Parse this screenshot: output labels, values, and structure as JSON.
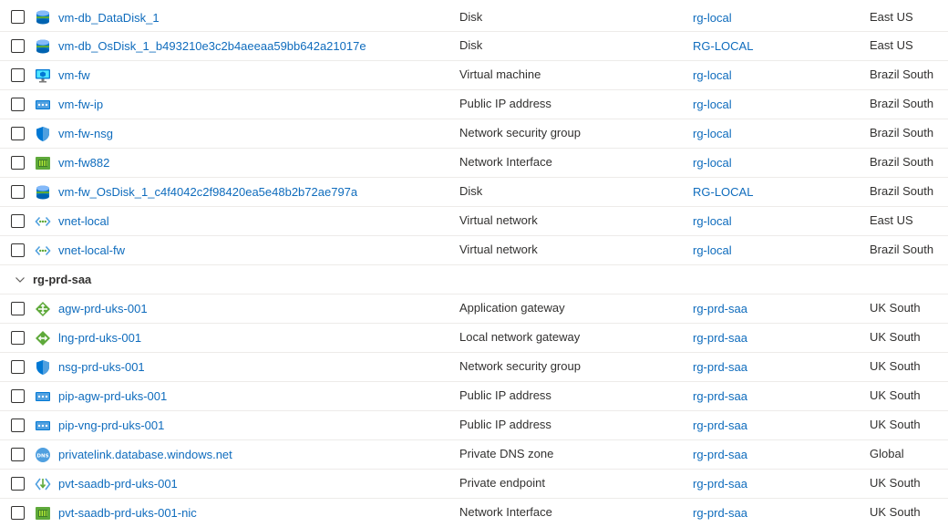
{
  "colors": {
    "link": "#0f6cbd",
    "text": "#323130",
    "divider": "#edebe9"
  },
  "rows_top": [
    {
      "name": "vm-db_DataDisk_1",
      "type": "Disk",
      "rg": "rg-local",
      "location": "East US",
      "icon": "disk-icon"
    },
    {
      "name": "vm-db_OsDisk_1_b493210e3c2b4aeeaa59bb642a21017e",
      "type": "Disk",
      "rg": "RG-LOCAL",
      "location": "East US",
      "icon": "disk-icon"
    },
    {
      "name": "vm-fw",
      "type": "Virtual machine",
      "rg": "rg-local",
      "location": "Brazil South",
      "icon": "virtual-machine-icon"
    },
    {
      "name": "vm-fw-ip",
      "type": "Public IP address",
      "rg": "rg-local",
      "location": "Brazil South",
      "icon": "public-ip-icon"
    },
    {
      "name": "vm-fw-nsg",
      "type": "Network security group",
      "rg": "rg-local",
      "location": "Brazil South",
      "icon": "shield-icon"
    },
    {
      "name": "vm-fw882",
      "type": "Network Interface",
      "rg": "rg-local",
      "location": "Brazil South",
      "icon": "network-interface-icon"
    },
    {
      "name": "vm-fw_OsDisk_1_c4f4042c2f98420ea5e48b2b72ae797a",
      "type": "Disk",
      "rg": "RG-LOCAL",
      "location": "Brazil South",
      "icon": "disk-icon"
    },
    {
      "name": "vnet-local",
      "type": "Virtual network",
      "rg": "rg-local",
      "location": "East US",
      "icon": "virtual-network-icon"
    },
    {
      "name": "vnet-local-fw",
      "type": "Virtual network",
      "rg": "rg-local",
      "location": "Brazil South",
      "icon": "virtual-network-icon"
    }
  ],
  "group": {
    "label": "rg-prd-saa",
    "icon": "chevron-down-icon"
  },
  "rows_group": [
    {
      "name": "agw-prd-uks-001",
      "type": "Application gateway",
      "rg": "rg-prd-saa",
      "location": "UK South",
      "icon": "application-gateway-icon"
    },
    {
      "name": "lng-prd-uks-001",
      "type": "Local network gateway",
      "rg": "rg-prd-saa",
      "location": "UK South",
      "icon": "local-network-gateway-icon"
    },
    {
      "name": "nsg-prd-uks-001",
      "type": "Network security group",
      "rg": "rg-prd-saa",
      "location": "UK South",
      "icon": "shield-icon"
    },
    {
      "name": "pip-agw-prd-uks-001",
      "type": "Public IP address",
      "rg": "rg-prd-saa",
      "location": "UK South",
      "icon": "public-ip-icon"
    },
    {
      "name": "pip-vng-prd-uks-001",
      "type": "Public IP address",
      "rg": "rg-prd-saa",
      "location": "UK South",
      "icon": "public-ip-icon"
    },
    {
      "name": "privatelink.database.windows.net",
      "type": "Private DNS zone",
      "rg": "rg-prd-saa",
      "location": "Global",
      "icon": "dns-zone-icon"
    },
    {
      "name": "pvt-saadb-prd-uks-001",
      "type": "Private endpoint",
      "rg": "rg-prd-saa",
      "location": "UK South",
      "icon": "private-endpoint-icon"
    },
    {
      "name": "pvt-saadb-prd-uks-001-nic",
      "type": "Network Interface",
      "rg": "rg-prd-saa",
      "location": "UK South",
      "icon": "network-interface-icon"
    }
  ]
}
